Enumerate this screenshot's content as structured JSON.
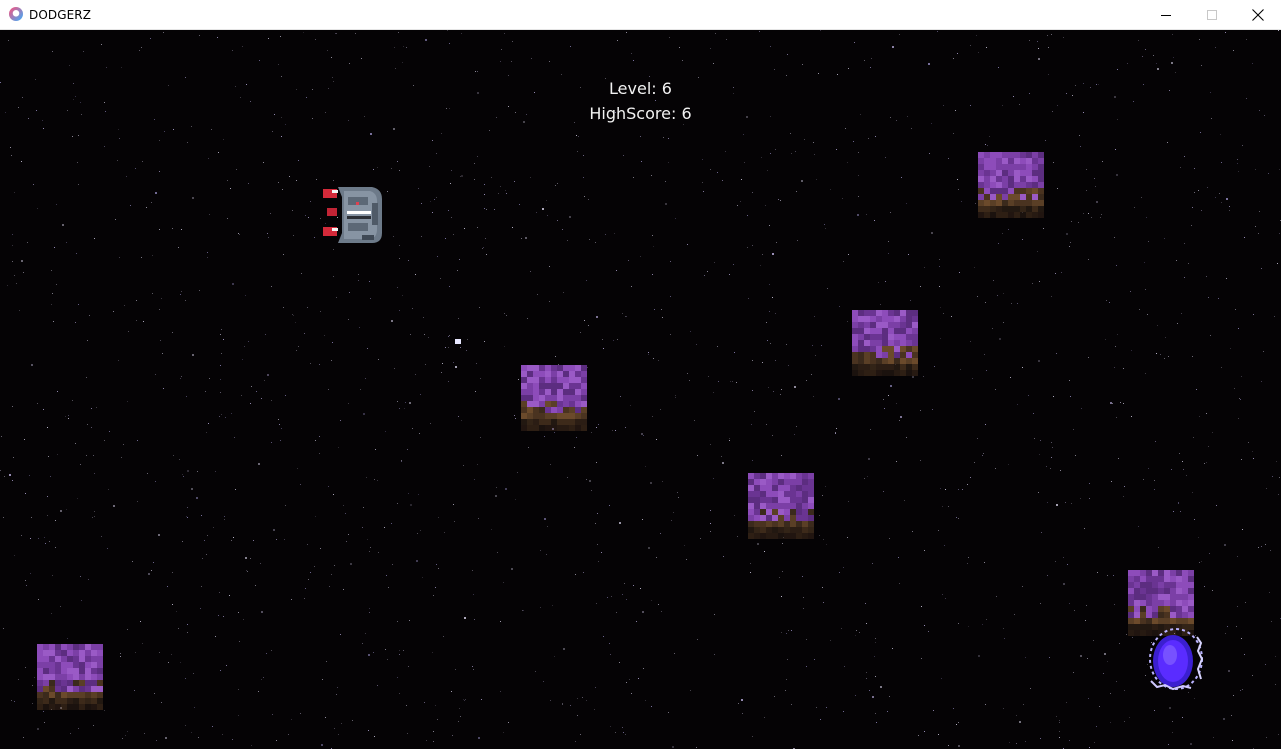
{
  "window": {
    "title": "DODGERZ",
    "icon": "app-logo-icon",
    "controls": [
      "minimize-icon",
      "maximize-icon",
      "close-icon"
    ]
  },
  "hud": {
    "level_text": "Level: 6",
    "highscore_text": "HighScore: 6"
  },
  "colors": {
    "background": "#050305",
    "asteroid_purple": "#7b3fa6",
    "asteroid_brown": "#4a3320",
    "ship_gray": "#6d7a89",
    "ship_thruster_red": "#d42a3a",
    "portal_blue": "#5a2cff",
    "hud_text": "#f2f2f2"
  },
  "entities": {
    "player": "spaceship",
    "asteroids": 6,
    "projectile": "bullet",
    "portal": "exit-portal"
  }
}
